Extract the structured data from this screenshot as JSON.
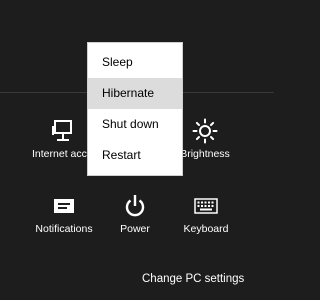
{
  "settings": {
    "network_label": "Internet access",
    "brightness_label": "Brightness",
    "notifications_label": "Notifications",
    "power_label": "Power",
    "keyboard_label": "Keyboard",
    "change_pc_settings": "Change PC settings"
  },
  "power_menu": {
    "items": [
      {
        "label": "Sleep",
        "highlighted": false
      },
      {
        "label": "Hibernate",
        "highlighted": true
      },
      {
        "label": "Shut down",
        "highlighted": false
      },
      {
        "label": "Restart",
        "highlighted": false
      }
    ]
  },
  "icons": {
    "network": "network-icon",
    "brightness": "brightness-icon",
    "notifications": "notifications-icon",
    "power": "power-icon",
    "keyboard": "keyboard-icon"
  },
  "colors": {
    "background": "#1d1d1d",
    "menu_background": "#ffffff",
    "menu_highlight": "#dcdcdc",
    "text": "#ffffff"
  }
}
